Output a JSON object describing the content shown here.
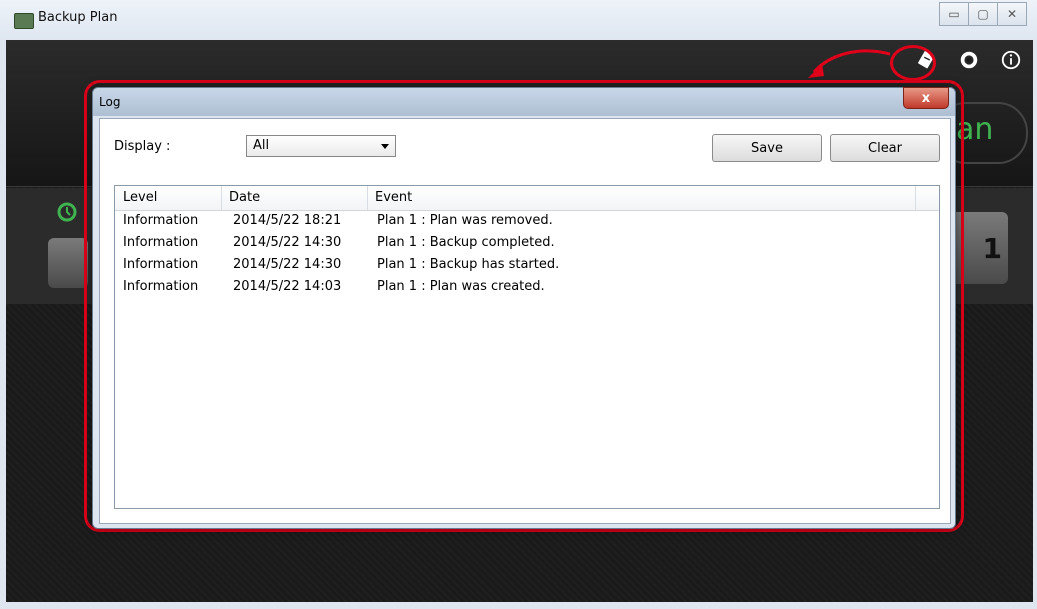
{
  "window": {
    "title": "Backup Plan",
    "controls": {
      "minimize": "▭",
      "maximize": "▢",
      "close": "✕"
    }
  },
  "app": {
    "top_icons": [
      "log-icon",
      "gear-icon",
      "info-icon"
    ],
    "background_text": {
      "plan_fragment": "an",
      "card_number": "1"
    },
    "accent_color": "#3fb34f",
    "highlight_color": "#e0001a"
  },
  "log_dialog": {
    "title": "Log",
    "close_label": "x",
    "display_label": "Display :",
    "display_selected": "All",
    "save_label": "Save",
    "clear_label": "Clear",
    "columns": [
      "Level",
      "Date",
      "Event"
    ],
    "rows": [
      {
        "level": "Information",
        "date": "2014/5/22 18:21",
        "event": "Plan 1 : Plan was removed."
      },
      {
        "level": "Information",
        "date": "2014/5/22 14:30",
        "event": "Plan 1 : Backup completed."
      },
      {
        "level": "Information",
        "date": "2014/5/22 14:30",
        "event": "Plan 1 : Backup has started."
      },
      {
        "level": "Information",
        "date": "2014/5/22 14:03",
        "event": "Plan 1 : Plan was created."
      }
    ]
  }
}
